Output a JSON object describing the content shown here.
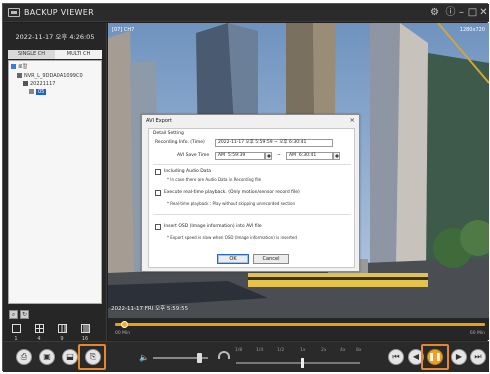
{
  "app": {
    "title": "BACKUP VIEWER"
  },
  "left_panel": {
    "datetime": "2022-11-17 오후 4:26:05",
    "tabs": {
      "single": "SINGLE CH",
      "multi": "MULTI CH"
    },
    "tree": {
      "root": "로컬",
      "device": "NVR_L_9DDA0A1099C0",
      "date": "20221117",
      "channel": "05"
    },
    "split_options": [
      "1",
      "4",
      "9",
      "16"
    ]
  },
  "video": {
    "channel_label": "[07] CH7",
    "speed_label": "1280x720",
    "timestamp": "2022-11-17 FRI 오후 5:59:55"
  },
  "dialog": {
    "title": "AVI Export",
    "close_glyph": "×",
    "section_label": "Detail Setting",
    "recording_info_label": "Recording Info. (Time)",
    "recording_info_value": "2022-11-17 오후 5:59:59 ~ 오후 6:30:41",
    "save_time_label": "AVI Save Time",
    "start_ampm": "AM",
    "start_time": "5:59:39",
    "range_sep": "~",
    "end_ampm": "AM",
    "end_time": "6:30:41",
    "include_audio_label": "Including Audio Data",
    "include_audio_note": "* In case there are Audio Data in Recording file",
    "realtime_label": "Execute real-time playback. (Only motion/sensor record file)",
    "realtime_note": "* Real-time playback : Play without skipping unrecorded section",
    "osd_label": "Insert OSD (Image information) into AVI file",
    "osd_note": "* Export speed is slow when OSD (Image information) is inserted",
    "ok_label": "OK",
    "cancel_label": "Cancel"
  },
  "timeline": {
    "start_label": "00 Min",
    "end_label": "60 Min"
  },
  "controls": {
    "speed_ticks": [
      "1/8",
      "1/4",
      "1/2",
      "1x",
      "2x",
      "4x",
      "8x"
    ]
  },
  "colors": {
    "highlight": "#e6862d",
    "timeline_bar": "#e8a10a",
    "selected_tree": "#1e64c8"
  },
  "icons": {
    "settings": "gear-icon",
    "info": "info-icon",
    "minimize": "minimize-icon",
    "maximize": "maximize-icon",
    "close": "close-icon"
  }
}
